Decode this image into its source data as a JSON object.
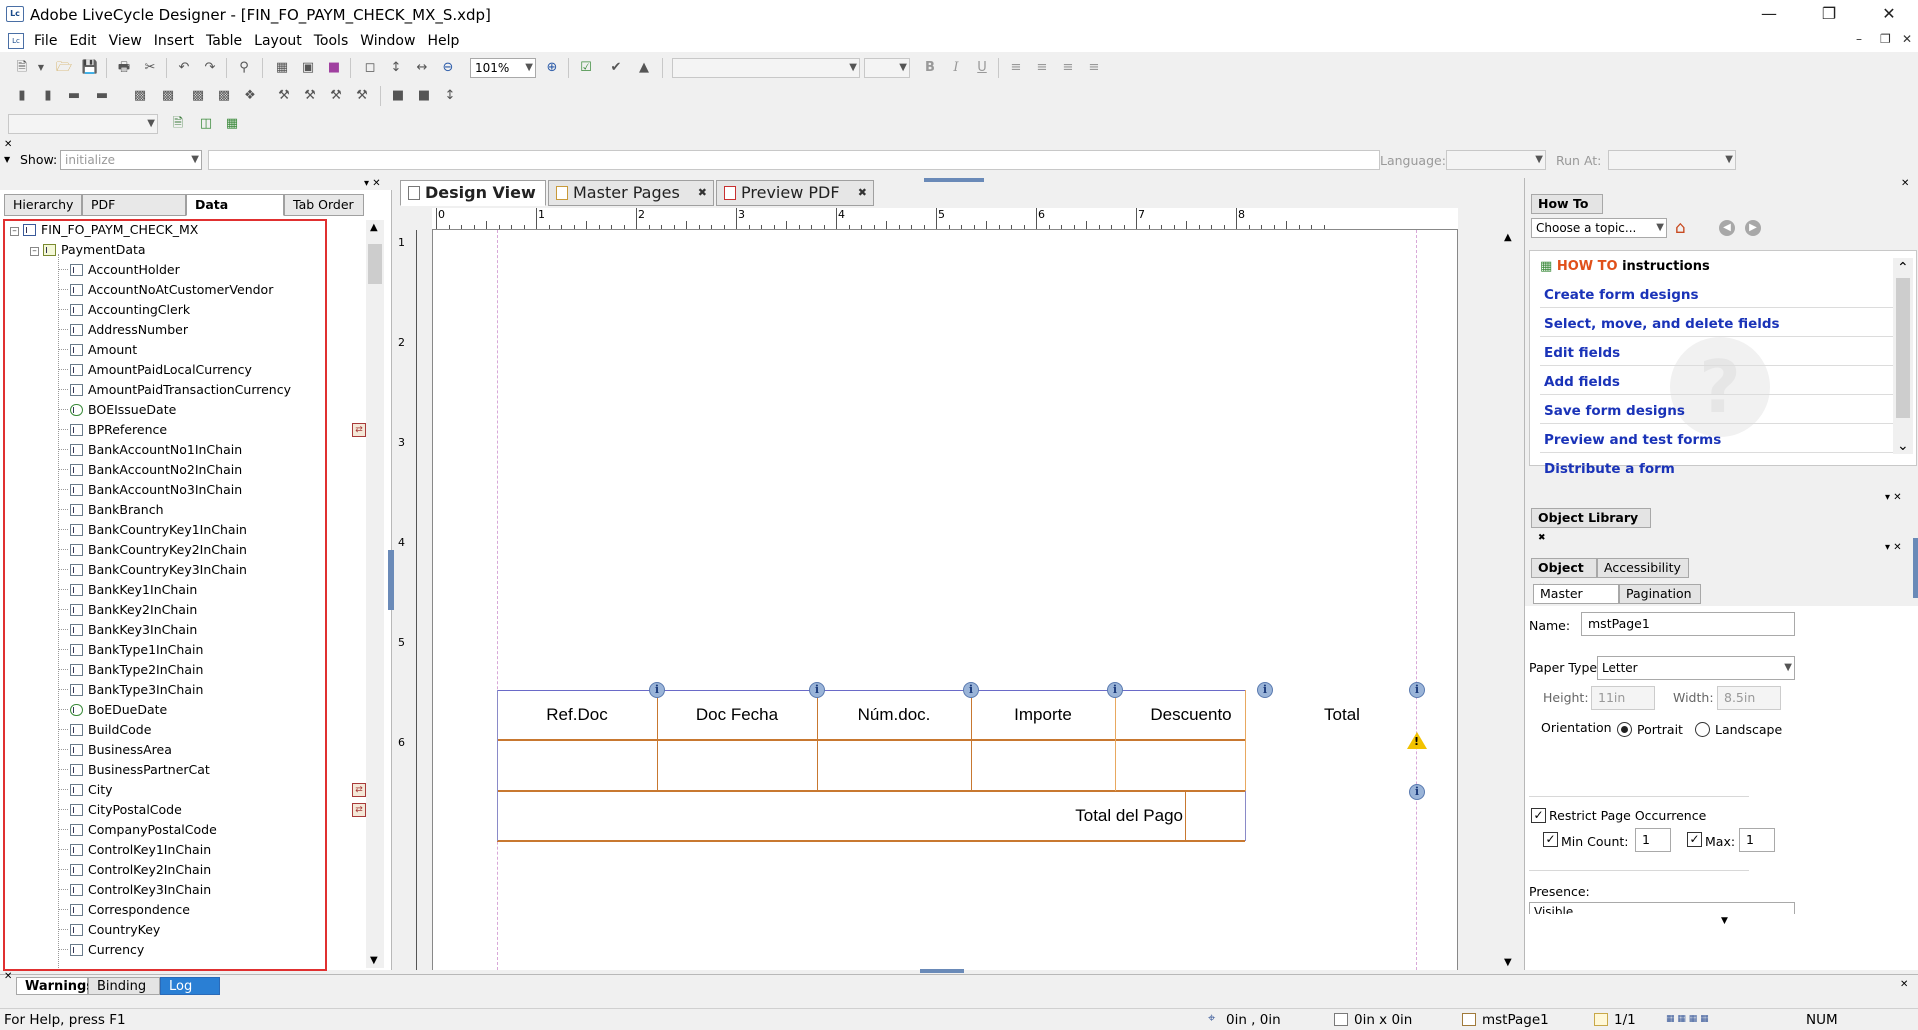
{
  "window": {
    "title": "Adobe LiveCycle Designer - [FIN_FO_PAYM_CHECK_MX_S.xdp]",
    "app_icon": "Lc"
  },
  "menu": [
    "File",
    "Edit",
    "View",
    "Insert",
    "Table",
    "Layout",
    "Tools",
    "Window",
    "Help"
  ],
  "toolbar": {
    "zoom": "101%"
  },
  "scriptbar": {
    "show_label": "Show:",
    "show_value": "initialize",
    "language_label": "Language:",
    "run_at_label": "Run At:"
  },
  "left_panel": {
    "tabs": [
      "Hierarchy",
      "PDF Structure",
      "Data View",
      "Tab Order"
    ],
    "active_tab": "Data View",
    "root": "FIN_FO_PAYM_CHECK_MX",
    "group": "PaymentData",
    "fields": [
      {
        "name": "AccountHolder",
        "type": "field"
      },
      {
        "name": "AccountNoAtCustomerVendor",
        "type": "field"
      },
      {
        "name": "AccountingClerk",
        "type": "field"
      },
      {
        "name": "AddressNumber",
        "type": "field"
      },
      {
        "name": "Amount",
        "type": "field"
      },
      {
        "name": "AmountPaidLocalCurrency",
        "type": "field"
      },
      {
        "name": "AmountPaidTransactionCurrency",
        "type": "field"
      },
      {
        "name": "BOEIssueDate",
        "type": "date"
      },
      {
        "name": "BPReference",
        "type": "field",
        "bound": true
      },
      {
        "name": "BankAccountNo1InChain",
        "type": "field"
      },
      {
        "name": "BankAccountNo2InChain",
        "type": "field"
      },
      {
        "name": "BankAccountNo3InChain",
        "type": "field"
      },
      {
        "name": "BankBranch",
        "type": "field"
      },
      {
        "name": "BankCountryKey1InChain",
        "type": "field"
      },
      {
        "name": "BankCountryKey2InChain",
        "type": "field"
      },
      {
        "name": "BankCountryKey3InChain",
        "type": "field"
      },
      {
        "name": "BankKey1InChain",
        "type": "field"
      },
      {
        "name": "BankKey2InChain",
        "type": "field"
      },
      {
        "name": "BankKey3InChain",
        "type": "field"
      },
      {
        "name": "BankType1InChain",
        "type": "field"
      },
      {
        "name": "BankType2InChain",
        "type": "field"
      },
      {
        "name": "BankType3InChain",
        "type": "field"
      },
      {
        "name": "BoEDueDate",
        "type": "date"
      },
      {
        "name": "BuildCode",
        "type": "field"
      },
      {
        "name": "BusinessArea",
        "type": "field"
      },
      {
        "name": "BusinessPartnerCat",
        "type": "field"
      },
      {
        "name": "City",
        "type": "field",
        "bound": true
      },
      {
        "name": "CityPostalCode",
        "type": "field",
        "bound": true
      },
      {
        "name": "CompanyPostalCode",
        "type": "field"
      },
      {
        "name": "ControlKey1InChain",
        "type": "field"
      },
      {
        "name": "ControlKey2InChain",
        "type": "field"
      },
      {
        "name": "ControlKey3InChain",
        "type": "field"
      },
      {
        "name": "Correspondence",
        "type": "field"
      },
      {
        "name": "CountryKey",
        "type": "field"
      },
      {
        "name": "Currency",
        "type": "field"
      }
    ]
  },
  "design": {
    "tabs": [
      "Design View",
      "Master Pages",
      "Preview PDF"
    ],
    "active_tab": "Design View",
    "ruler_h": [
      "0",
      "1",
      "2",
      "3",
      "4",
      "5",
      "6",
      "7",
      "8"
    ],
    "ruler_v": [
      "1",
      "2",
      "3",
      "4",
      "5",
      "6"
    ],
    "table_headers": [
      "Ref.Doc",
      "Doc Fecha",
      "Núm.doc.",
      "Importe",
      "Descuento",
      "Total"
    ],
    "total_label": "Total del Pago"
  },
  "right_panel": {
    "howto": {
      "title": "How To",
      "topic_placeholder": "Choose a topic...",
      "heading_accent": "HOW TO",
      "heading_rest": "instructions",
      "links": [
        "Create form designs",
        "Select, move, and delete fields",
        "Edit fields",
        "Add fields",
        "Save form designs",
        "Preview and test forms",
        "Distribute a form"
      ]
    },
    "object_library": "Object Library",
    "object_tabs": [
      "Object",
      "Accessibility"
    ],
    "object_subtabs": [
      "Master Page",
      "Pagination"
    ],
    "props": {
      "name_label": "Name:",
      "name_value": "mstPage1",
      "paper_type_label": "Paper Type:",
      "paper_type_value": "Letter",
      "height_label": "Height:",
      "height_value": "11in",
      "width_label": "Width:",
      "width_value": "8.5in",
      "orientation_label": "Orientation",
      "portrait": "Portrait",
      "landscape": "Landscape",
      "restrict_label": "Restrict Page Occurrence",
      "min_label": "Min Count:",
      "min_value": "1",
      "max_label": "Max:",
      "max_value": "1",
      "presence_label": "Presence:",
      "presence_value": "Visible"
    }
  },
  "bottom_tabs": [
    "Warnings",
    "Binding",
    "Log"
  ],
  "status": {
    "help": "For Help, press F1",
    "position": "0in , 0in",
    "size": "0in x 0in",
    "page": "mstPage1",
    "count": "1/1",
    "num": "NUM"
  },
  "colors": {
    "link": "#1a33b8",
    "highlight": "#e03030",
    "table_line": "#c87830",
    "table_top": "#6a6ac8",
    "log_tab": "#2a7fd4"
  }
}
